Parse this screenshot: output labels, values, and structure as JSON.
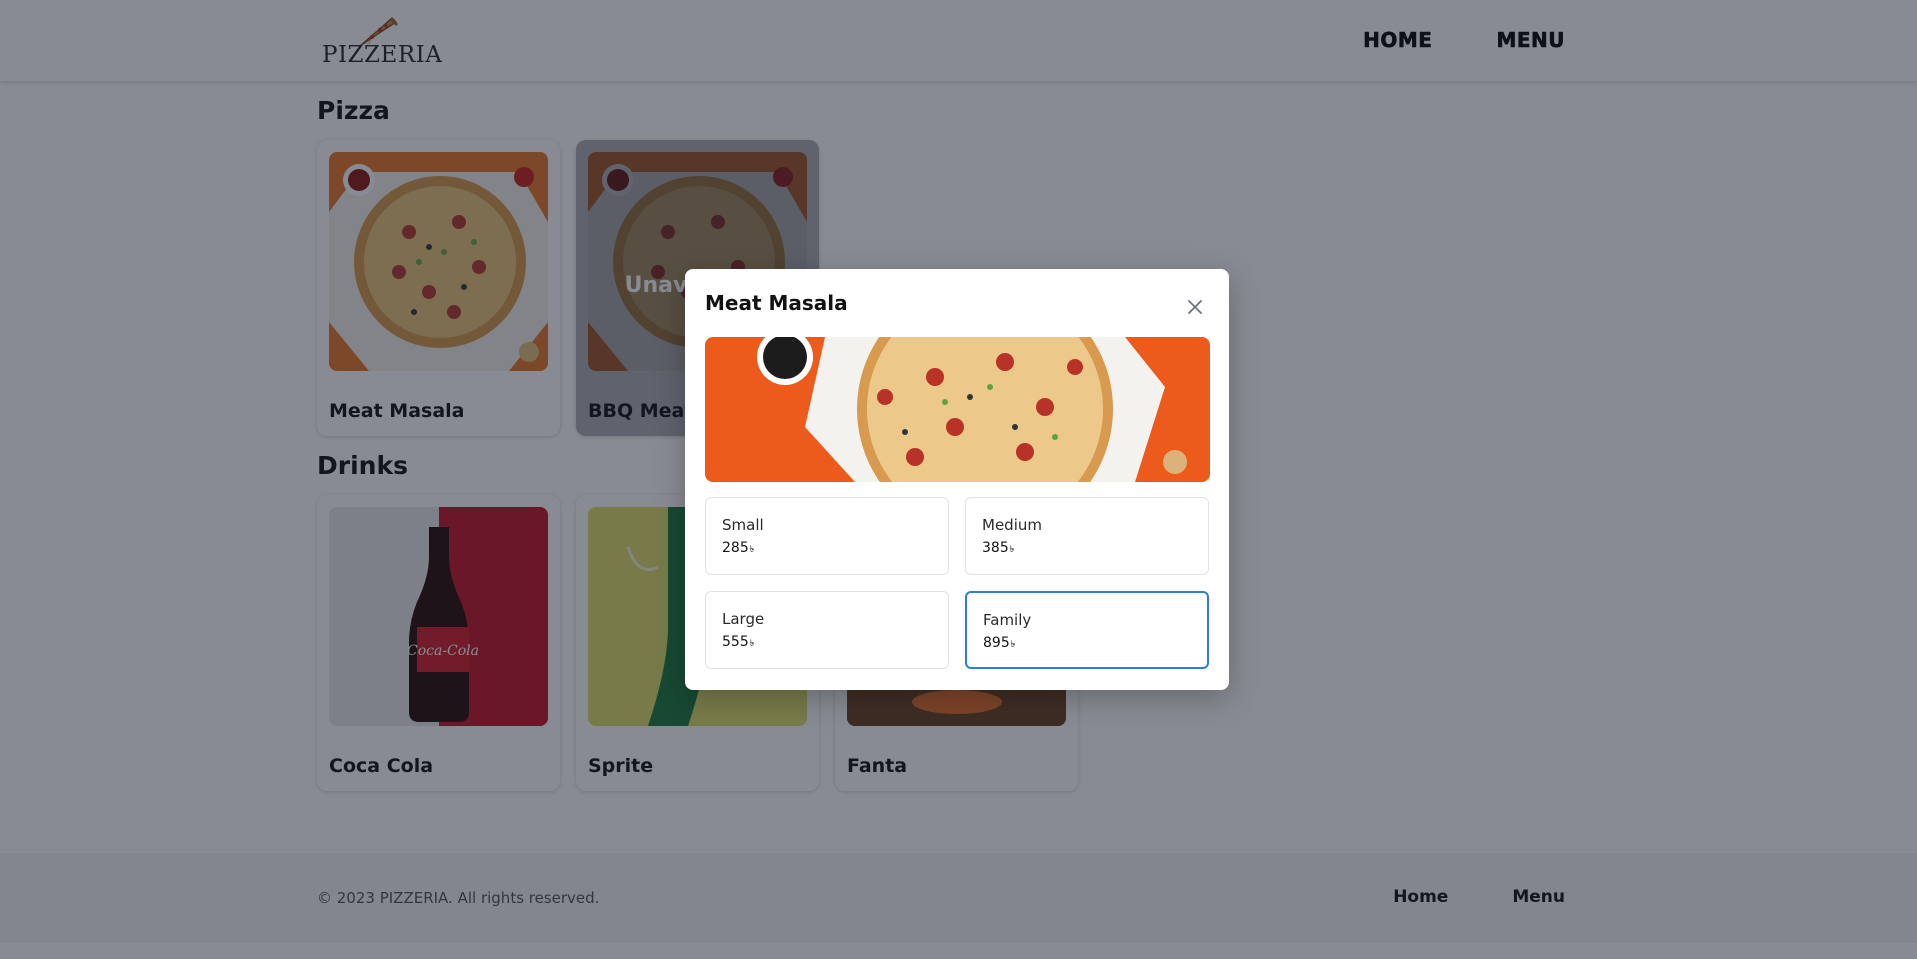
{
  "header": {
    "logo_text": "PIZZERIA",
    "nav": [
      "HOME",
      "MENU"
    ]
  },
  "sections": {
    "pizza": {
      "title": "Pizza",
      "items": [
        {
          "name": "Meat Masala",
          "image": "pizza-image",
          "available": true
        },
        {
          "name": "BBQ Meat",
          "image": "pizza-image",
          "available": false,
          "badge": "Unavailable"
        }
      ]
    },
    "drinks": {
      "title": "Drinks",
      "items": [
        {
          "name": "Coca Cola",
          "image": "coca-cola-image"
        },
        {
          "name": "Sprite",
          "image": "sprite-image"
        },
        {
          "name": "Fanta",
          "image": "fanta-image"
        }
      ]
    }
  },
  "footer": {
    "copyright": "© 2023 PIZZERIA. All rights reserved.",
    "links": [
      "Home",
      "Menu"
    ]
  },
  "modal": {
    "title": "Meat Masala",
    "close_icon": "close-icon",
    "currency_symbol": "৳",
    "sizes": [
      {
        "name": "Small",
        "price": "285",
        "selected": false
      },
      {
        "name": "Medium",
        "price": "385",
        "selected": false
      },
      {
        "name": "Large",
        "price": "555",
        "selected": false
      },
      {
        "name": "Family",
        "price": "895",
        "selected": true
      }
    ],
    "selected_border_color": "#2f7be0"
  },
  "colors": {
    "overlay": "rgba(17,24,39,0.5)",
    "background": "#ffffff",
    "footer_bg": "#f5f5f5"
  }
}
